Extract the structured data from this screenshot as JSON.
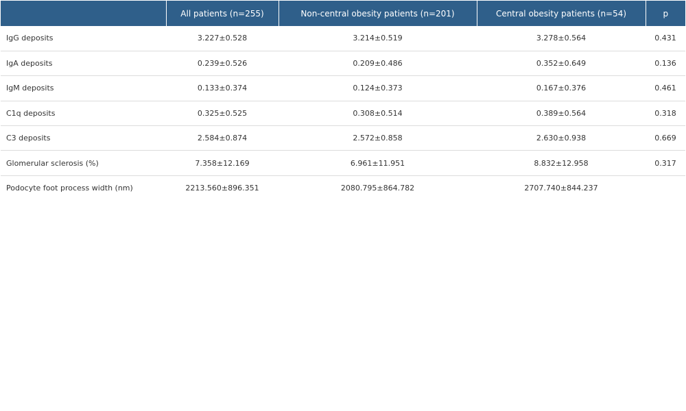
{
  "table": {
    "headers": [
      "",
      "All patients (n=255)",
      "Non-central obesity patients (n=201)",
      "Central obesity patients (n=54)",
      "p"
    ],
    "rows": [
      [
        "IgG deposits",
        "3.227±0.528",
        "3.214±0.519",
        "3.278±0.564",
        "0.431"
      ],
      [
        "IgA deposits",
        "0.239±0.526",
        "0.209±0.486",
        "0.352±0.649",
        "0.136"
      ],
      [
        "IgM deposits",
        "0.133±0.374",
        "0.124±0.373",
        "0.167±0.376",
        "0.461"
      ],
      [
        "C1q deposits",
        "0.325±0.525",
        "0.308±0.514",
        "0.389±0.564",
        "0.318"
      ],
      [
        "C3 deposits",
        "2.584±0.874",
        "2.572±0.858",
        "2.630±0.938",
        "0.669"
      ],
      [
        "Glomerular sclerosis (%)",
        "7.358±12.169",
        "6.961±11.951",
        "8.832±12.958",
        "0.317"
      ],
      [
        "Podocyte foot process width (nm)",
        "2213.560±896.351",
        "2080.795±864.782",
        "2707.740±844.237",
        ""
      ]
    ]
  },
  "colors": {
    "header_background": "#2f5f8a",
    "header_text": "#ffffff",
    "row_divider": "#dcdcdc",
    "body_text": "#333333"
  }
}
